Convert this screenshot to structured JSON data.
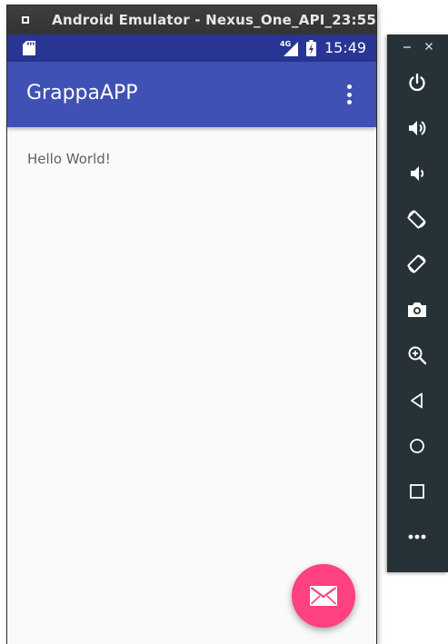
{
  "window": {
    "title": "Android Emulator - Nexus_One_API_23:55"
  },
  "statusbar": {
    "network_label": "4G",
    "time": "15:49"
  },
  "appbar": {
    "title": "GrappaAPP"
  },
  "content": {
    "text": "Hello World!"
  },
  "colors": {
    "statusbar": "#283593",
    "appbar": "#3f51b5",
    "fab": "#ff4081",
    "side_panel": "#263238",
    "screen_background": "#fafafa"
  },
  "side_toolbar": {
    "header_icons": [
      "minimize-icon",
      "close-icon"
    ],
    "buttons": [
      "power-icon",
      "volume-up-icon",
      "volume-down-icon",
      "rotate-left-icon",
      "rotate-right-icon",
      "camera-icon",
      "zoom-icon",
      "back-icon",
      "home-icon",
      "overview-icon",
      "more-icon"
    ]
  },
  "fab": {
    "icon": "email-icon"
  }
}
